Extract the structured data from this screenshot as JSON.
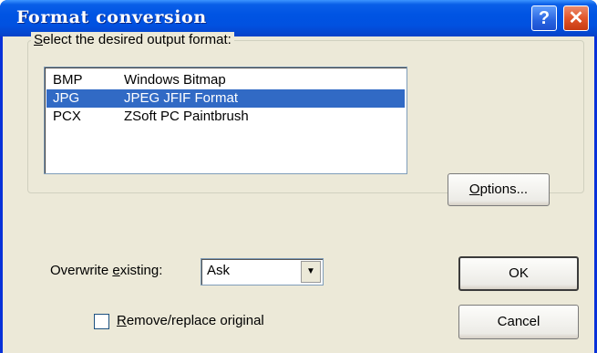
{
  "window": {
    "title": "Format conversion",
    "help_glyph": "?",
    "close_glyph": "✕"
  },
  "group": {
    "label_prefix": "",
    "label_mnemonic": "S",
    "label_rest": "elect the desired output format:"
  },
  "formats": [
    {
      "code": "BMP",
      "description": "Windows Bitmap",
      "selected": false
    },
    {
      "code": "JPG",
      "description": "JPEG JFIF Format",
      "selected": true
    },
    {
      "code": "PCX",
      "description": "ZSoft PC Paintbrush",
      "selected": false
    }
  ],
  "options_button": {
    "mnemonic": "O",
    "rest": "ptions..."
  },
  "overwrite": {
    "label_prefix": "Overwrite ",
    "label_mnemonic": "e",
    "label_rest": "xisting:",
    "value": "Ask"
  },
  "remove_original": {
    "mnemonic": "R",
    "rest": "emove/replace original",
    "checked": false
  },
  "ok_button": {
    "label": "OK"
  },
  "cancel_button": {
    "label": "Cancel"
  },
  "icons": {
    "help": "help-icon",
    "close": "close-icon",
    "dropdown": "chevron-down-icon"
  },
  "colors": {
    "title_bar": "#0054e3",
    "selection": "#316ac5",
    "dialog_bg": "#ece9d8"
  }
}
